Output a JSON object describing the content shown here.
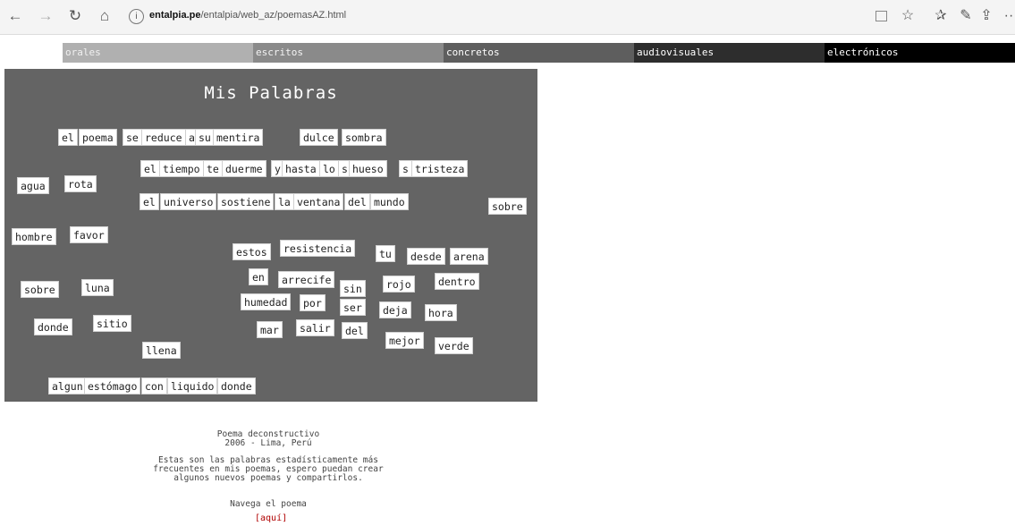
{
  "browser": {
    "back_icon": "←",
    "forward_icon": "→",
    "refresh_icon": "↻",
    "home_icon": "⌂",
    "info_icon": "i",
    "url_host": "entalpia.pe",
    "url_path": "/entalpia/web_az/poemasAZ.html",
    "favorite_icon": "☆",
    "favorites_bar_icon": "✰",
    "pen_icon": "✎",
    "share_icon": "⇪",
    "more_icon": "··"
  },
  "categories": [
    "orales",
    "escritos",
    "concretos",
    "audiovisuales",
    "electrónicos"
  ],
  "board": {
    "title": "Mis Palabras",
    "words": [
      "el",
      "poema",
      "se",
      "reduce",
      "a",
      "su",
      "mentira",
      "dulce",
      "sombra",
      "el",
      "tiempo",
      "te",
      "duerme",
      "y",
      "hasta",
      "lo",
      "s",
      "hueso",
      "s",
      "tristeza",
      "agua",
      "rota",
      "el",
      "universo",
      "sostiene",
      "la",
      "ventana",
      "del",
      "mundo",
      "sobre",
      "hombre",
      "favor",
      "estos",
      "resistencia",
      "tu",
      "desde",
      "arena",
      "en",
      "arrecife",
      "sin",
      "rojo",
      "dentro",
      "sobre",
      "luna",
      "humedad",
      "por",
      "ser",
      "deja",
      "hora",
      "donde",
      "sitio",
      "mar",
      "salir",
      "del",
      "mejor",
      "verde",
      "llena",
      "algun",
      "estómago",
      "con",
      "liquido",
      "donde"
    ]
  },
  "info": {
    "heading": "Poema deconstructivo\n2006 - Lima, Perú",
    "description": "Estas son las palabras estadísticamente más\nfrecuentes en mis poemas, espero puedan crear\nalgunos nuevos poemas y compartirlos.",
    "navigate": "Navega el poema",
    "link": "[aquí]"
  }
}
